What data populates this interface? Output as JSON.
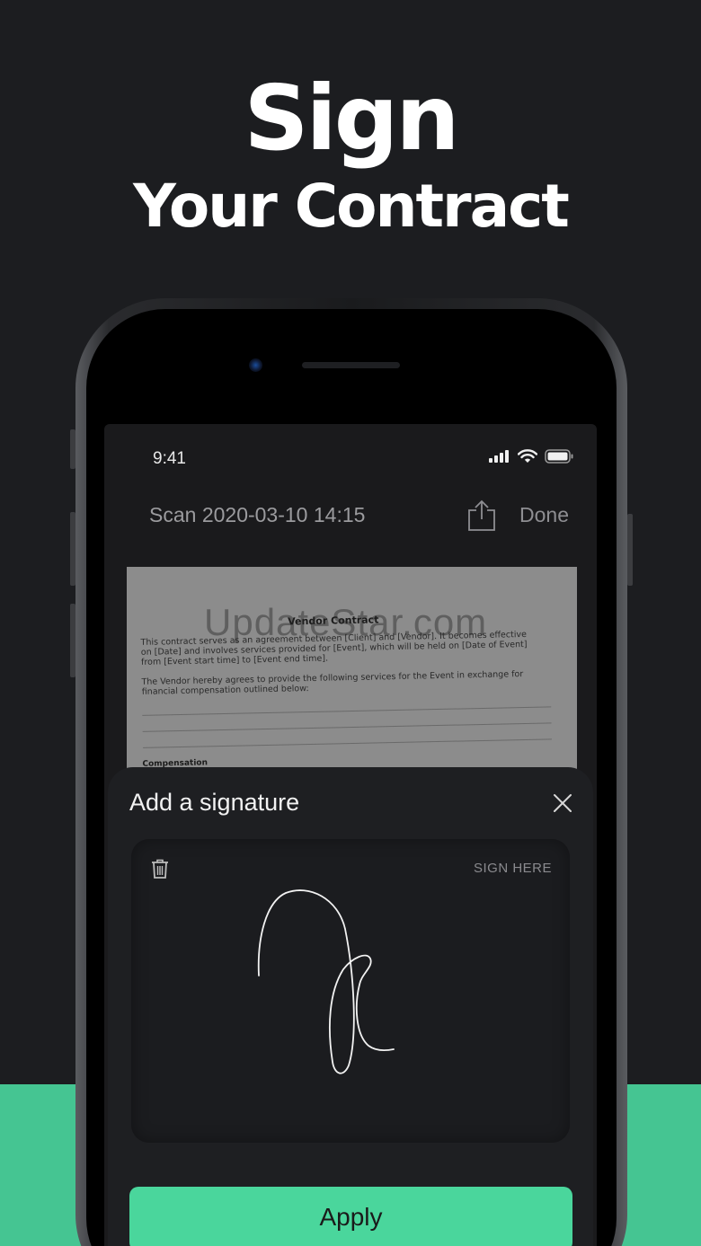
{
  "headline": {
    "line1": "Sign",
    "line2": "Your Contract"
  },
  "colors": {
    "background": "#1c1d20",
    "accent": "#45c592",
    "button": "#4ad69c"
  },
  "status_bar": {
    "time": "9:41",
    "icons": [
      "signal-icon",
      "wifi-icon",
      "battery-icon"
    ]
  },
  "nav": {
    "title": "Scan 2020-03-10 14:15",
    "share_icon": "share-icon",
    "done_label": "Done"
  },
  "document": {
    "watermark": "UpdateStar.com",
    "title": "Vendor Contract",
    "paragraph1": "This contract serves as an agreement between [Client] and [Vendor]. It becomes effective on [Date] and involves services provided for [Event], which will be held on [Date of Event] from [Event start time] to [Event end time].",
    "paragraph2": "The Vendor hereby agrees to provide the following services for the Event in exchange for financial compensation outlined below:",
    "section": "Compensation"
  },
  "sheet": {
    "title": "Add a signature",
    "close_icon": "close-icon",
    "trash_icon": "trash-icon",
    "sign_here": "SIGN HERE",
    "apply_label": "Apply"
  }
}
